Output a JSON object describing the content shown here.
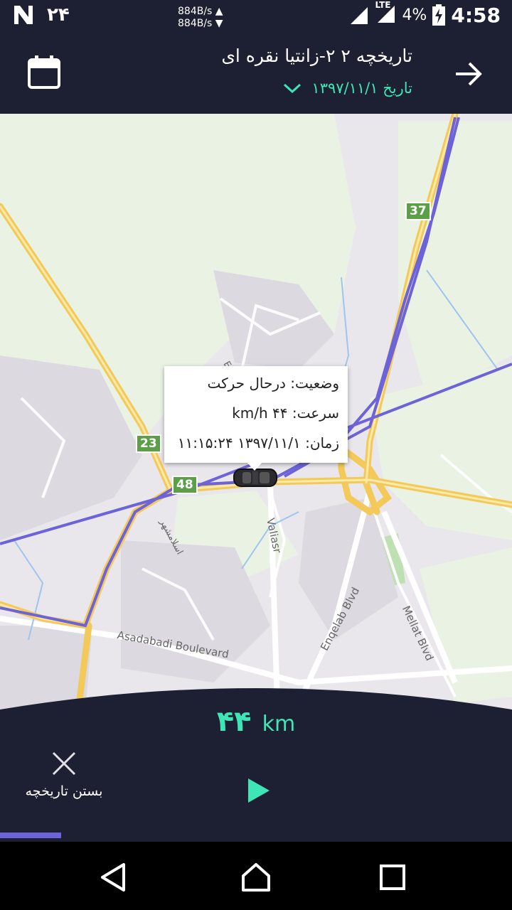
{
  "status_bar": {
    "notification_count": "۲۴",
    "net_up": "884B/s",
    "net_down": "884B/s",
    "network_type": "LTE",
    "battery": "4%",
    "time": "4:58"
  },
  "header": {
    "title": "تاریخچه ۲ ۲-زانتیا نقره ای",
    "date_label": "تاریخ ۱۳۹۷/۱۱/۱",
    "calendar_icon": "calendar-icon",
    "back_icon": "arrow-right-icon",
    "accent_color": "#3ee6b6"
  },
  "map": {
    "route_color": "#6d63d8",
    "popup": {
      "status": "وضعیت: درحال حرکت",
      "speed": "سرعت: ۴۴ km/h",
      "time": "زمان: ۱۳۹۷/۱۱/۱ ۱۱:۱۵:۲۴"
    },
    "road_shields": [
      "37",
      "23",
      "48"
    ],
    "street_labels": [
      "Asadabadi Boulevard",
      "Valiasr",
      "Enqelab Blvd",
      "Mellat Blvd",
      "اسلامشهر",
      "E"
    ]
  },
  "bottom_panel": {
    "distance_value": "۴۴",
    "distance_unit": "km",
    "close_label": "بستن تاریخچه",
    "playback_progress": 0.12
  },
  "nav_bar": {
    "back": "back-icon",
    "home": "home-icon",
    "recents": "recents-icon"
  }
}
